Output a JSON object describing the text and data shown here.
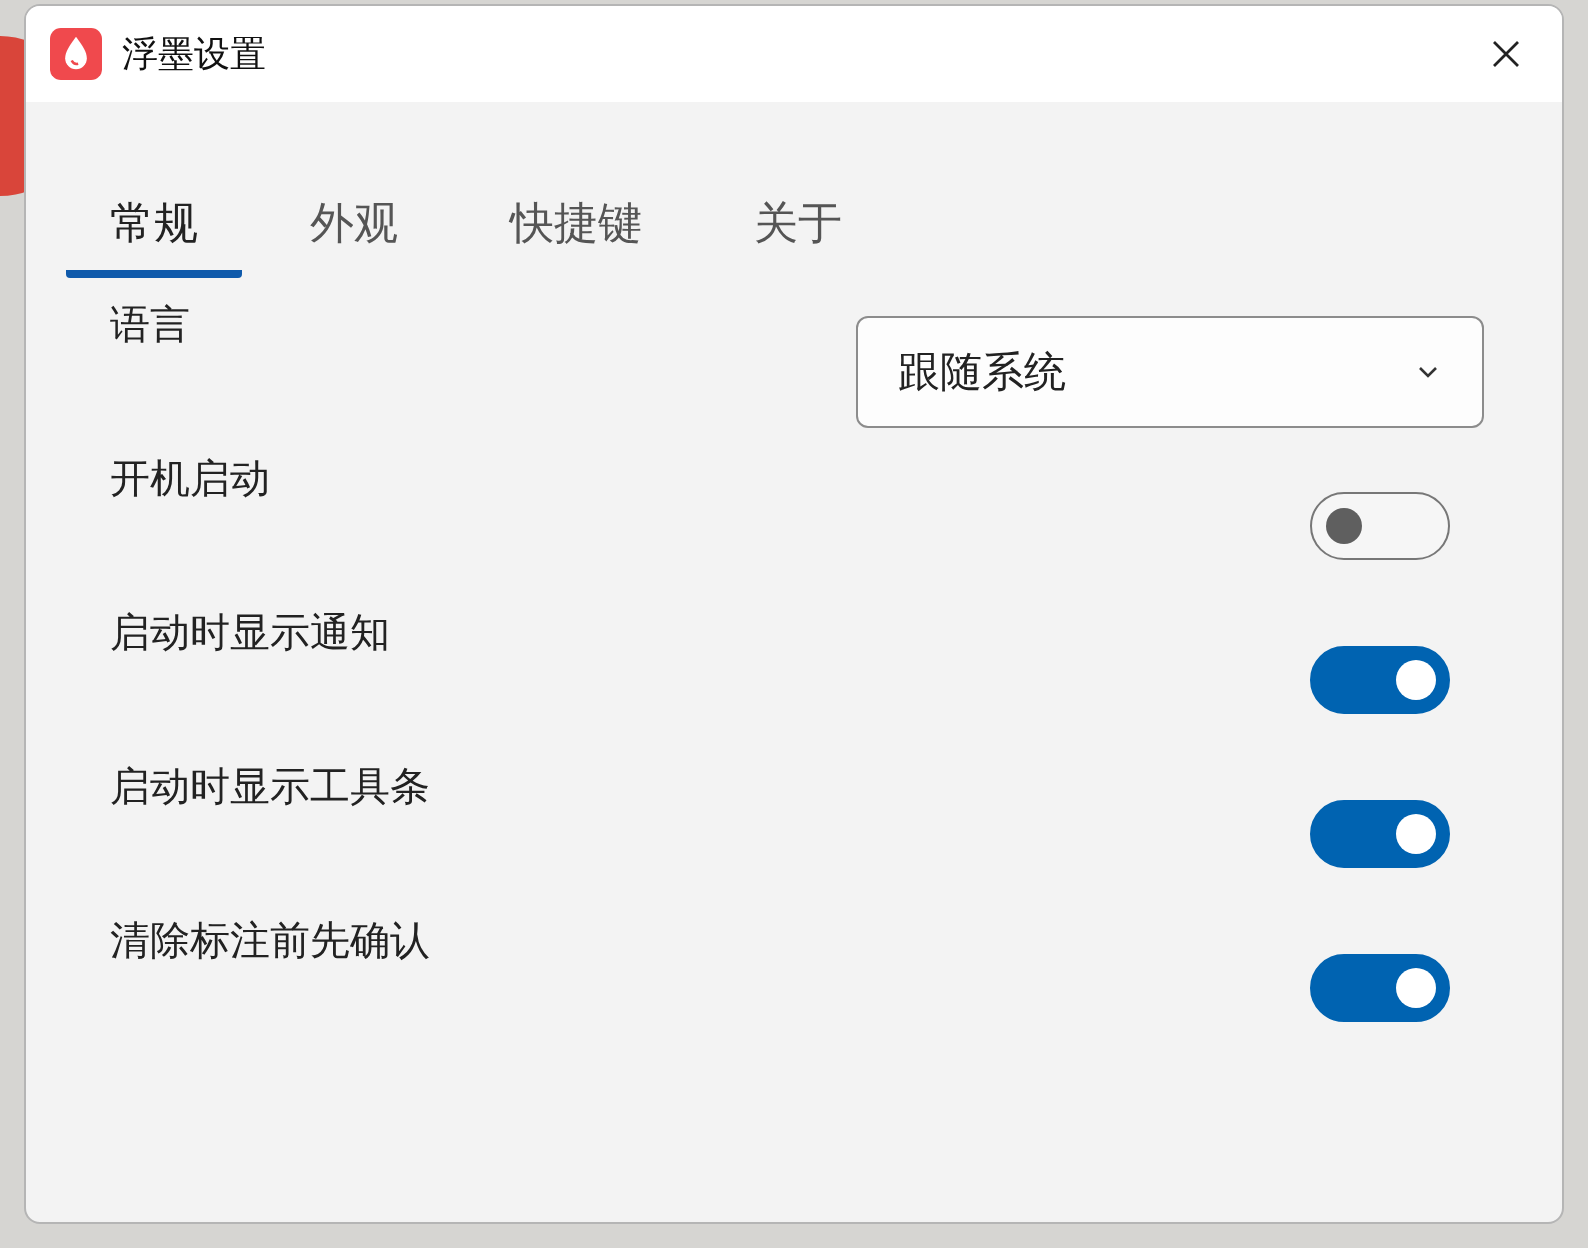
{
  "window": {
    "title": "浮墨设置"
  },
  "tabs": [
    {
      "label": "常规",
      "selected": true
    },
    {
      "label": "外观",
      "selected": false
    },
    {
      "label": "快捷键",
      "selected": false
    },
    {
      "label": "关于",
      "selected": false
    }
  ],
  "settings": [
    {
      "kind": "dropdown",
      "label": "语言",
      "value": "跟随系统"
    },
    {
      "kind": "toggle",
      "label": "开机启动",
      "on": false
    },
    {
      "kind": "toggle",
      "label": "启动时显示通知",
      "on": true
    },
    {
      "kind": "toggle",
      "label": "启动时显示工具条",
      "on": true
    },
    {
      "kind": "toggle",
      "label": "清除标注前先确认",
      "on": true
    }
  ]
}
